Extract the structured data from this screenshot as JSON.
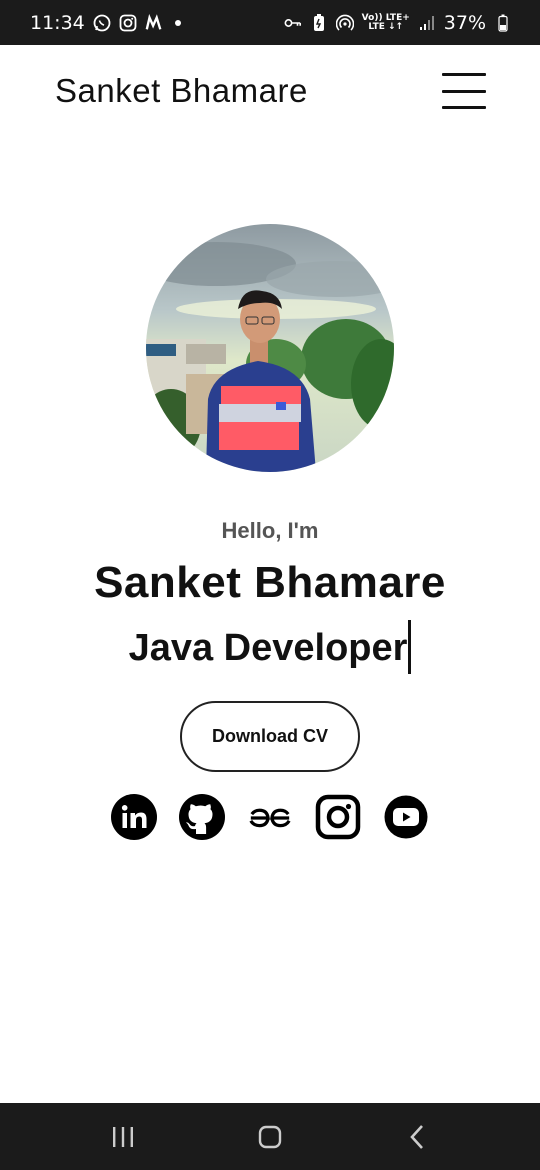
{
  "status_bar": {
    "time": "11:34",
    "battery_percent": "37%",
    "network_label_top": "Vo)) LTE+",
    "network_label_bottom": "LTE ↓↑",
    "notification_icons": [
      "whatsapp-icon",
      "instagram-icon",
      "m-app-icon"
    ],
    "system_icons": [
      "vpn-key-icon",
      "battery-saver-icon",
      "hotspot-icon",
      "signal-icon",
      "battery-icon"
    ]
  },
  "header": {
    "title": "Sanket Bhamare",
    "menu_icon": "hamburger-menu-icon"
  },
  "hero": {
    "greeting": "Hello, I'm",
    "name": "Sanket Bhamare",
    "role": "Java Developer",
    "download_cv_label": "Download CV"
  },
  "socials": [
    {
      "name": "linkedin-icon"
    },
    {
      "name": "github-icon"
    },
    {
      "name": "geeksforgeeks-icon"
    },
    {
      "name": "instagram-icon"
    },
    {
      "name": "youtube-icon"
    }
  ],
  "nav_bar": {
    "buttons": [
      "recent-apps-icon",
      "home-icon",
      "back-icon"
    ]
  },
  "colors": {
    "status_bar_bg": "#1b1b1b",
    "text": "#111111",
    "greeting": "#555555",
    "background": "#ffffff"
  }
}
